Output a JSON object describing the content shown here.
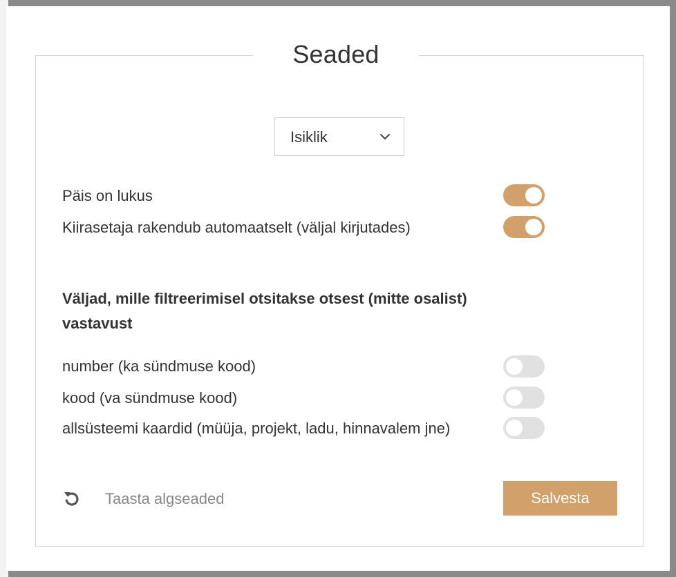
{
  "dialog": {
    "title": "Seaded"
  },
  "profile_select": {
    "value": "Isiklik"
  },
  "settings": [
    {
      "label": "Päis on lukus",
      "enabled": true
    },
    {
      "label": "Kiirasetaja rakendub automaatselt (väljal kirjutades)",
      "enabled": true
    }
  ],
  "exact_match": {
    "heading": "Väljad, mille filtreerimisel otsitakse otsest (mitte osalist) vastavust",
    "fields": [
      {
        "label": "number (ka sündmuse kood)",
        "enabled": false
      },
      {
        "label": "kood (va sündmuse kood)",
        "enabled": false
      },
      {
        "label": "allsüsteemi kaardid (müüja, projekt, ladu, hinnavalem jne)",
        "enabled": false
      }
    ]
  },
  "footer": {
    "reset_label": "Taasta algseaded",
    "save_label": "Salvesta"
  },
  "colors": {
    "accent": "#d2a06b",
    "toggle_off": "#e1e1e1",
    "overlay": "#8a8a8a"
  },
  "icons": {
    "dropdown": "chevron-down-icon",
    "reset": "undo-icon"
  }
}
